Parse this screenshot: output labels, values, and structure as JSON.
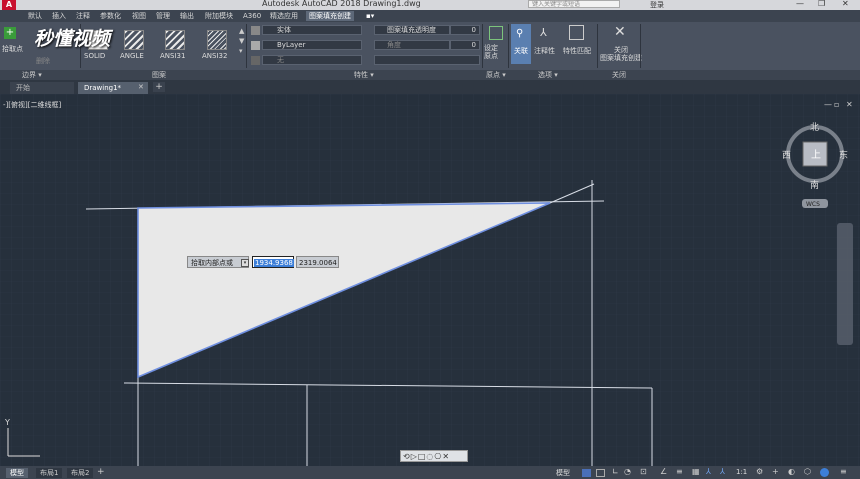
{
  "title_bar": {
    "title": "Autodesk AutoCAD 2018    Drawing1.dwg",
    "search_placeholder": "键入关键字或短语",
    "user": "登录",
    "min": "—",
    "restore": "❐",
    "close": "✕"
  },
  "menu_tabs": [
    "默认",
    "插入",
    "注释",
    "参数化",
    "视图",
    "管理",
    "输出",
    "附加模块",
    "A360",
    "精选应用",
    "图案填充创建"
  ],
  "ribbon": {
    "pick_points_label": "拾取点",
    "remove_label": "删除",
    "patterns": [
      "SOLID",
      "ANGLE",
      "ANSI31",
      "ANSI32"
    ],
    "hatch_type": "实体",
    "hatch_transparency_label": "图案填充透明度",
    "hatch_transparency": "0",
    "color": "ByLayer",
    "angle_label": "角度",
    "angle": "0",
    "background": "无",
    "set_origin": "设定\n原点",
    "associative": "关联",
    "annotative": "注释性",
    "match_properties": "特性匹配",
    "close_label": "关闭\n图案填充创建",
    "panel_labels": {
      "boundary": "边界 ▾",
      "pattern": "图案",
      "properties": "特性 ▾",
      "origin": "原点 ▾",
      "options": "选项 ▾",
      "close": "关闭"
    }
  },
  "watermark": "秒懂视频",
  "file_tabs": [
    {
      "label": "开始",
      "active": false
    },
    {
      "label": "Drawing1*",
      "active": true
    }
  ],
  "viewport": {
    "label": "-][俯视][二维线框]",
    "dyn_prompt": "拾取内部点或",
    "dyn_x": "1934.9368",
    "dyn_y": "2319.0064"
  },
  "viewcube": {
    "north": "北",
    "south": "南",
    "east": "东",
    "west": "西",
    "top": "上",
    "wcs": "WCS"
  },
  "ucs": {
    "y": "Y"
  },
  "layout_tabs": [
    "模型",
    "布局1",
    "布局2"
  ],
  "status": {
    "model": "模型",
    "scale": "1:1"
  },
  "colors": {
    "background": "#26303c",
    "grid": "#2e3846",
    "hatch_fill": "#e8e8e8",
    "selected_edge": "#6f8fe0",
    "line": "#d8dde6",
    "active_ribbon_btn": "#5a7fb0"
  }
}
